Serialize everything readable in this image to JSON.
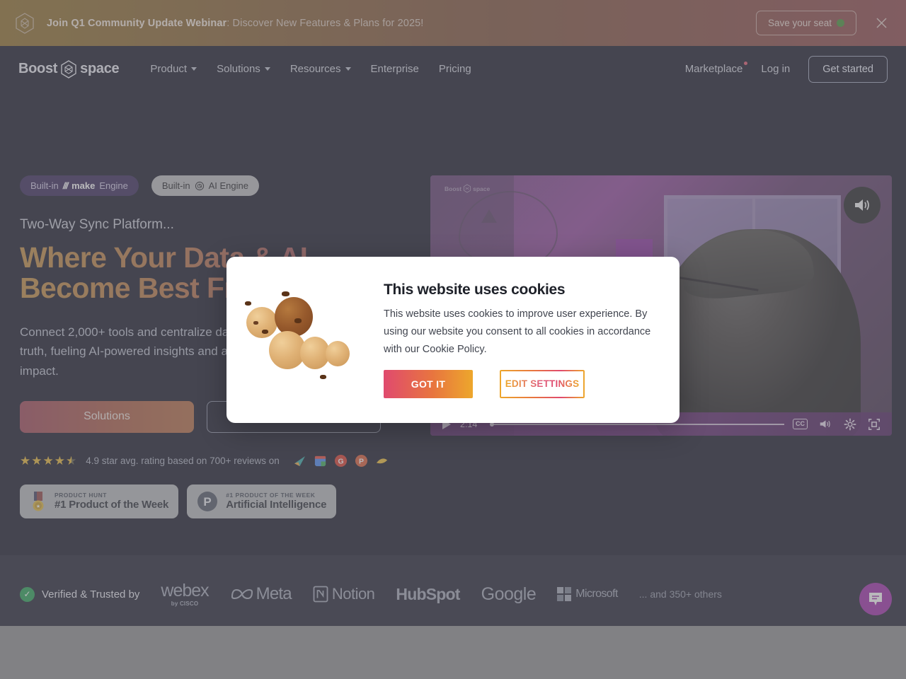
{
  "banner": {
    "logo_icon": "hexagon-logo-icon",
    "headline_bold": "Join Q1 Community Update Webinar",
    "headline_rest": ": Discover New Features & Plans for 2025!",
    "cta_label": "Save your seat",
    "cta_dot_color": "#3d8c2e",
    "close_icon": "close-icon"
  },
  "nav": {
    "logo_left": "Boost",
    "logo_right": "space",
    "links": [
      {
        "label": "Product",
        "has_caret": true
      },
      {
        "label": "Solutions",
        "has_caret": true
      },
      {
        "label": "Resources",
        "has_caret": true
      },
      {
        "label": "Enterprise",
        "has_caret": false
      },
      {
        "label": "Pricing",
        "has_caret": false
      }
    ],
    "marketplace": "Marketplace",
    "login": "Log in",
    "get_started": "Get started"
  },
  "hero": {
    "pill_make_pre": "Built-in",
    "pill_make_brand": "make",
    "pill_make_post": "Engine",
    "pill_ai_pre": "Built-in",
    "pill_ai_post": "AI Engine",
    "eyebrow": "Two-Way Sync Platform...",
    "headline": "Where Your Data & AI Become Best Friends",
    "subtext": "Connect 2,000+ tools and centralize data into a single source of truth, fueling AI-powered insights and automation for strategic impact.",
    "btn_primary": "Solutions",
    "btn_secondary": "",
    "rating_text": "4.9 star avg. rating based on 700+ reviews on",
    "stars": 4.5,
    "review_icons": [
      "capterra-icon",
      "google-business-icon",
      "g2-icon",
      "product-hunt-icon",
      "crozdesk-icon"
    ],
    "badge_cards": [
      {
        "icon": "medal-icon",
        "sub": "PRODUCT HUNT",
        "main": "#1 Product of the Week"
      },
      {
        "icon": "product-hunt-icon",
        "sub": "#1 PRODUCT OF THE WEEK",
        "main": "Artificial Intelligence"
      }
    ]
  },
  "video": {
    "watermark_left": "Boost",
    "watermark_right": "space",
    "time": "2:14",
    "play_icon": "play-icon",
    "mute_icon": "volume-icon",
    "cc_label": "CC",
    "volume_icon": "volume-icon",
    "settings_icon": "gear-icon",
    "fullscreen_icon": "fullscreen-icon",
    "progress_percent": 0
  },
  "trusted": {
    "verified_label": "Verified & Trusted by",
    "logos": [
      {
        "name": "webex",
        "main": "webex",
        "sub": "by CISCO"
      },
      {
        "name": "meta",
        "main": "Meta"
      },
      {
        "name": "notion",
        "main": "Notion"
      },
      {
        "name": "hubspot",
        "main": "HubSpot"
      },
      {
        "name": "google",
        "main": "Google"
      },
      {
        "name": "microsoft",
        "main": "Microsoft"
      }
    ],
    "others": "... and 350+ others",
    "chat_icon": "chat-bubble-icon"
  },
  "cookie_dialog": {
    "title": "This website uses cookies",
    "body": "This website uses cookies to improve user experience. By using our website you consent to all cookies in accordance with our Cookie Policy.",
    "accept_label": "GOT IT",
    "edit_label": "EDIT SETTINGS",
    "art_icon": "cookies-illustration"
  },
  "colors": {
    "page_bg": "#0d0e20",
    "banner_gradient_start": "#8c6a23",
    "banner_gradient_end": "#8a3f44",
    "headline_gradient_start": "#c08a3e",
    "headline_gradient_end": "#a85358",
    "accent_pink": "#e04a6e",
    "accent_orange": "#eda72c",
    "chat_purple": "#9b25a7"
  }
}
